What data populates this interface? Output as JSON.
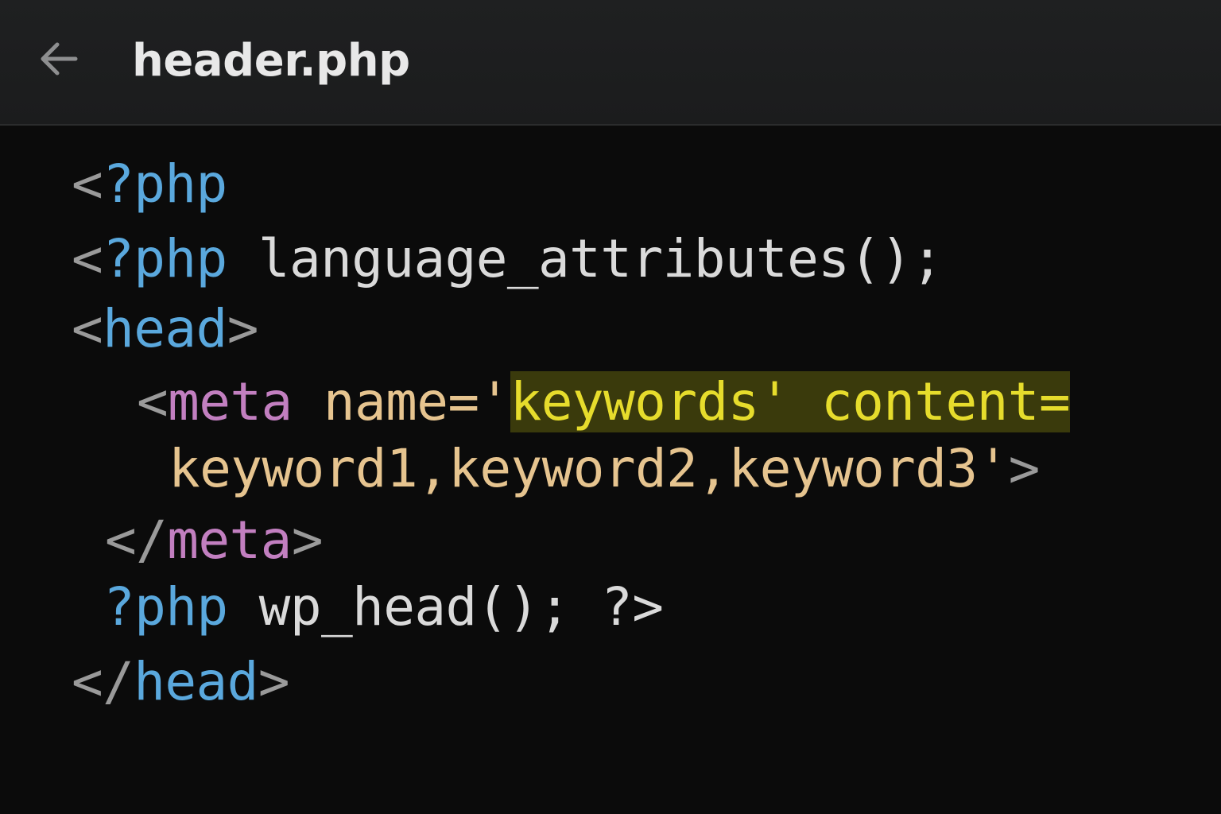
{
  "window": {
    "title": "header.php",
    "back_icon": "arrow-left-icon"
  },
  "editor": {
    "colors": {
      "background": "#0b0b0b",
      "punctuation": "#9a9a9a",
      "php_keyword": "#5aa8dd",
      "html_tag": "#5aa8dd",
      "meta_tag": "#c27fc0",
      "attribute": "#e6c48f",
      "highlight_text": "#e6dc2c",
      "highlight_bg": "#3a3a0c"
    },
    "lines": [
      {
        "tokens": [
          {
            "t": "<",
            "c": "punct"
          },
          {
            "t": "?php",
            "c": "php"
          }
        ]
      },
      {
        "tokens": [
          {
            "t": "<",
            "c": "punct"
          },
          {
            "t": "?php",
            "c": "php"
          },
          {
            "t": " language_attributes();",
            "c": "fn"
          }
        ]
      },
      {
        "tokens": [
          {
            "t": "<",
            "c": "punct"
          },
          {
            "t": "head",
            "c": "tag"
          },
          {
            "t": ">",
            "c": "punct"
          }
        ]
      },
      {
        "tokens": [
          {
            "t": "<",
            "c": "punct"
          },
          {
            "t": "meta",
            "c": "meta"
          },
          {
            "t": " name='",
            "c": "attr"
          },
          {
            "t": "keywords' content=",
            "c": "hl"
          }
        ]
      },
      {
        "tokens": [
          {
            "t": "keyword1,keyword2,keyword3'",
            "c": "str"
          },
          {
            "t": ">",
            "c": "punct"
          }
        ]
      },
      {
        "tokens": [
          {
            "t": "</",
            "c": "punct"
          },
          {
            "t": "meta",
            "c": "meta"
          },
          {
            "t": ">",
            "c": "punct"
          }
        ]
      },
      {
        "tokens": [
          {
            "t": "?php",
            "c": "php"
          },
          {
            "t": " wp_head(); ?>",
            "c": "fn"
          }
        ]
      },
      {
        "tokens": [
          {
            "t": "</",
            "c": "punct"
          },
          {
            "t": "head",
            "c": "tag"
          },
          {
            "t": ">",
            "c": "punct"
          }
        ]
      }
    ]
  }
}
